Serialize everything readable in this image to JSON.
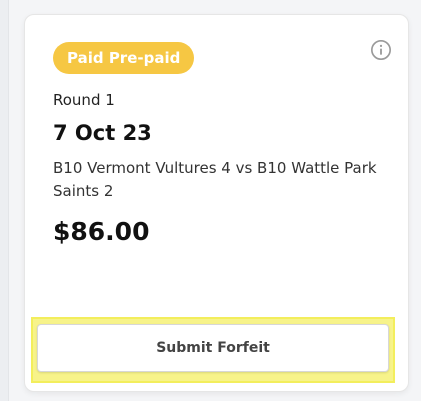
{
  "card": {
    "status_badge": "Paid Pre-paid",
    "round": "Round 1",
    "date": "7 Oct 23",
    "match": "B10 Vermont Vultures 4 vs B10 Wattle Park Saints 2",
    "amount": "$86.00",
    "forfeit_button_label": "Submit Forfeit",
    "info_icon": "info-icon"
  },
  "colors": {
    "badge_bg": "#f6c743",
    "badge_text": "#ffffff",
    "highlight": "#f7f38a"
  }
}
